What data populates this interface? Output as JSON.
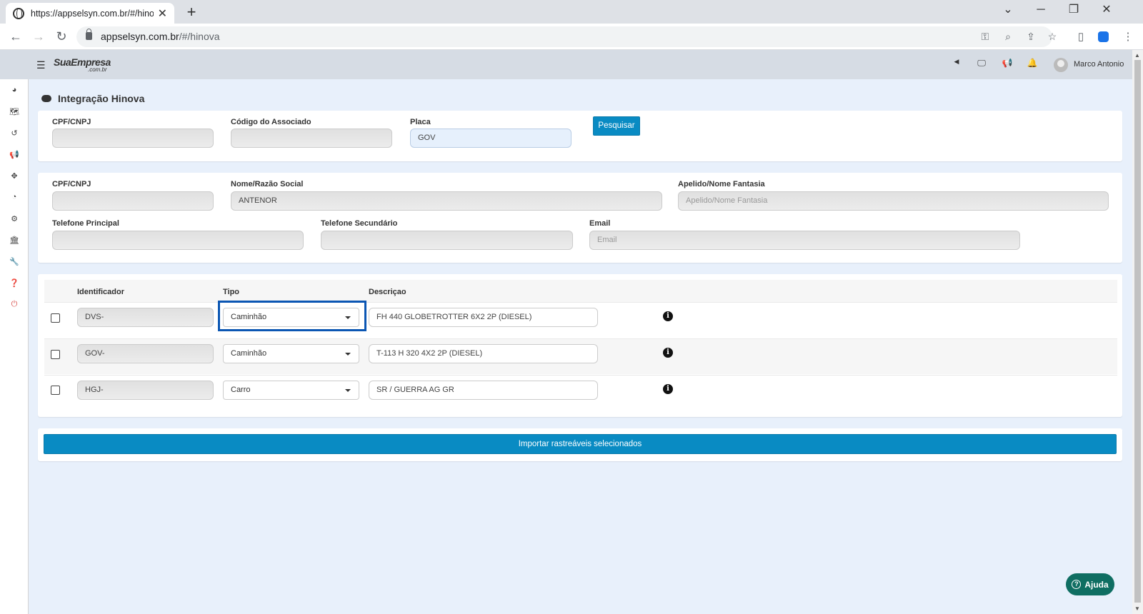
{
  "browser": {
    "tab_title": "https://appselsyn.com.br/#/hinova",
    "url_domain": "appselsyn.com.br",
    "url_path": "/#/hinova"
  },
  "header": {
    "logo": "SuaEmpresa",
    "logo_sub": ".com.br",
    "user_name": "Marco Antonio"
  },
  "page": {
    "title": "Integração Hinova"
  },
  "search": {
    "cpf_label": "CPF/CNPJ",
    "cpf_value": "",
    "codigo_label": "Código do Associado",
    "codigo_value": "",
    "placa_label": "Placa",
    "placa_value": "GOV",
    "button": "Pesquisar"
  },
  "associado": {
    "cpf_label": "CPF/CNPJ",
    "cpf_value": "",
    "nome_label": "Nome/Razão Social",
    "nome_value": "ANTENOR",
    "apelido_label": "Apelido/Nome Fantasia",
    "apelido_placeholder": "Apelido/Nome Fantasia",
    "tel1_label": "Telefone Principal",
    "tel1_value": "",
    "tel2_label": "Telefone Secundário",
    "tel2_value": "",
    "email_label": "Email",
    "email_placeholder": "Email"
  },
  "table": {
    "headers": [
      "Identificador",
      "Tipo",
      "Descriçao"
    ],
    "rows": [
      {
        "identificador": "DVS-",
        "tipo": "Caminhão",
        "descricao": "FH 440 GLOBETROTTER 6X2 2P (DIESEL)",
        "checked": false
      },
      {
        "identificador": "GOV-",
        "tipo": "Caminhão",
        "descricao": "T-113 H 320 4X2 2P (DIESEL)",
        "checked": false
      },
      {
        "identificador": "HGJ-",
        "tipo": "Carro",
        "descricao": "SR / GUERRA AG GR",
        "checked": false
      }
    ]
  },
  "import_button": "Importar rastreáveis selecionados",
  "help_button": "Ajuda",
  "colors": {
    "primary": "#098bc3",
    "help": "#0f6e62",
    "highlight": "#0b56b3",
    "background": "#e8f0fb"
  }
}
